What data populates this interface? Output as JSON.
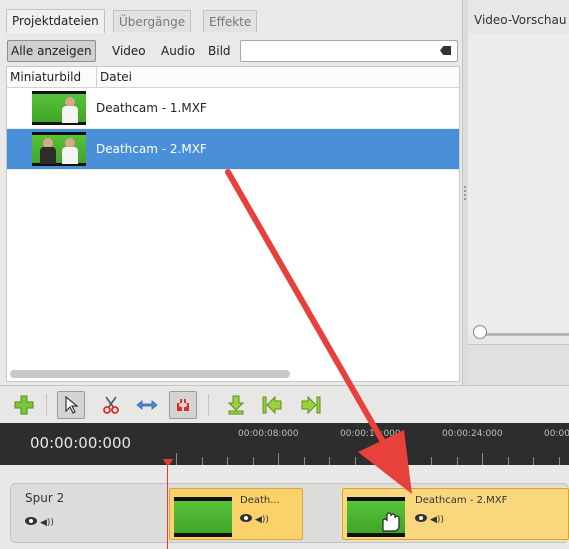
{
  "tabs": [
    {
      "label": "Projektdateien",
      "active": true
    },
    {
      "label": "Übergänge",
      "active": false
    },
    {
      "label": "Effekte",
      "active": false
    }
  ],
  "filter": {
    "buttons": [
      {
        "label": "Alle anzeigen",
        "active": true
      },
      {
        "label": "Video",
        "active": false
      },
      {
        "label": "Audio",
        "active": false
      },
      {
        "label": "Bild",
        "active": false
      }
    ],
    "search_value": ""
  },
  "file_list": {
    "columns": [
      "Miniaturbild",
      "Datei"
    ],
    "rows": [
      {
        "name": "Deathcam - 1.MXF",
        "selected": false
      },
      {
        "name": "Deathcam - 2.MXF",
        "selected": true
      }
    ]
  },
  "preview": {
    "title": "Video-Vorschau"
  },
  "toolbar": {
    "tools": [
      "add-icon",
      "pointer-icon",
      "razor-icon",
      "resize-icon",
      "snap-magnet-icon",
      "add-marker-icon",
      "jump-start-icon",
      "jump-end-icon"
    ]
  },
  "timeline": {
    "timecode": "00:00:00:000",
    "tick_labels": [
      "00:00:08:000",
      "00:00:16:000",
      "00:00:24:000",
      "00:00"
    ],
    "track_name": "Spur 2",
    "clips": [
      {
        "title": "Death..."
      },
      {
        "title": "Deathcam - 2.MXF"
      }
    ]
  },
  "colors": {
    "selection": "#4a90d9",
    "clip": "#fbd26a",
    "playhead": "#e23b3b",
    "annotation_arrow": "#e8413c"
  }
}
